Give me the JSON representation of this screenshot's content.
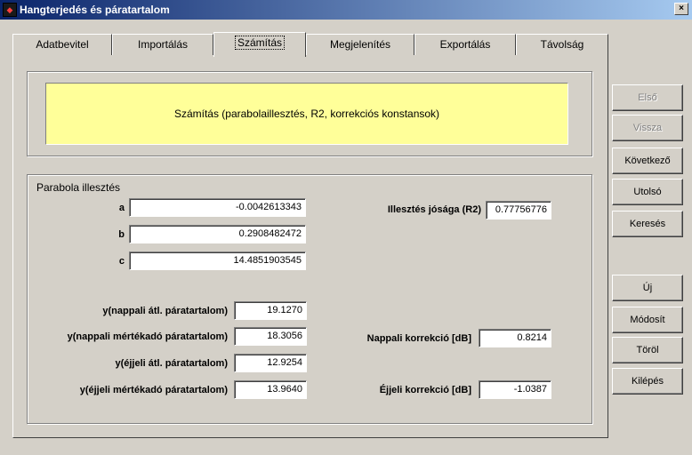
{
  "window": {
    "title": "Hangterjedés és páratartalom",
    "close_glyph": "×"
  },
  "tabs": [
    {
      "label": "Adatbevitel"
    },
    {
      "label": "Importálás"
    },
    {
      "label": "Számítás"
    },
    {
      "label": "Megjelenítés"
    },
    {
      "label": "Exportálás"
    },
    {
      "label": "Távolság"
    }
  ],
  "banner": {
    "text": "Számítás (parabolaillesztés, R2, korrekciós konstansok)"
  },
  "parabola": {
    "group_label": "Parabola illesztés",
    "a_label": "a",
    "a_value": "-0.0042613343",
    "b_label": "b",
    "b_value": "0.2908482472",
    "c_label": "c",
    "c_value": "14.4851903545",
    "r2_label": "Illesztés jósága (R2)",
    "r2_value": "0.77756776",
    "y_day_avg_label": "y(nappali átl. páratartalom)",
    "y_day_avg_value": "19.1270",
    "y_day_ref_label": "y(nappali mértékadó páratartalom)",
    "y_day_ref_value": "18.3056",
    "y_night_avg_label": "y(éjjeli átl. páratartalom)",
    "y_night_avg_value": "12.9254",
    "y_night_ref_label": "y(éjjeli mértékadó páratartalom)",
    "y_night_ref_value": "13.9640",
    "day_corr_label": "Nappali korrekció [dB]",
    "day_corr_value": "0.8214",
    "night_corr_label": "Éjjeli korrekció [dB]",
    "night_corr_value": "-1.0387"
  },
  "nav_buttons": {
    "first": "Első",
    "back": "Vissza",
    "next": "Következő",
    "last": "Utolsó",
    "search": "Keresés",
    "new": "Új",
    "modify": "Módosít",
    "delete": "Töröl",
    "exit": "Kilépés"
  }
}
